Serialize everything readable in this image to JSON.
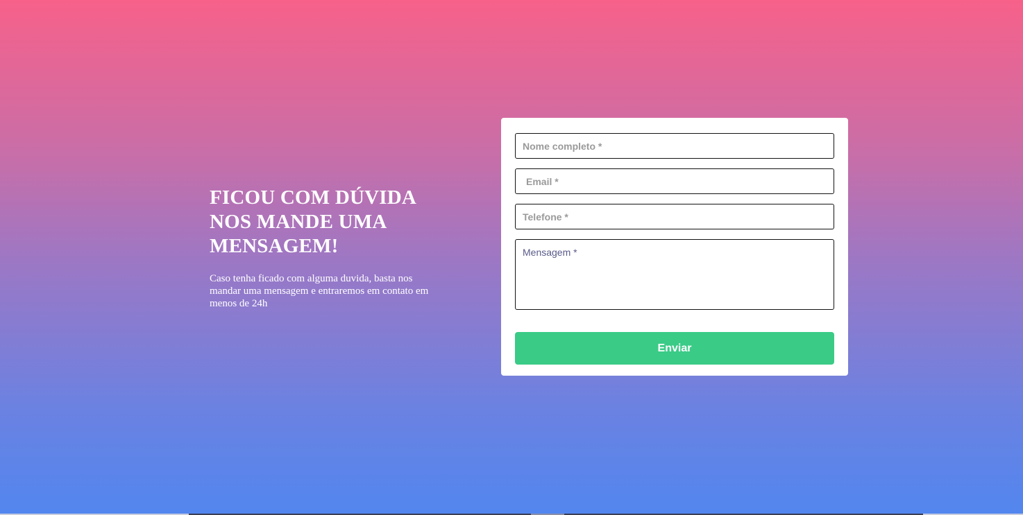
{
  "intro": {
    "heading_line1": "FICOU COM DÚVIDA",
    "heading_line2": "NOS MANDE UMA",
    "heading_line3": "MENSAGEM!",
    "description": "Caso tenha ficado com alguma duvida, basta nos mandar uma mensagem e entraremos em contato em menos de 24h"
  },
  "form": {
    "name_placeholder": "Nome completo *",
    "email_placeholder": "Email *",
    "phone_placeholder": "Telefone *",
    "message_placeholder": "Mensagem *",
    "submit_label": "Enviar"
  },
  "colors": {
    "gradient_top": "#f7618a",
    "gradient_bottom": "#5286ef",
    "button_green": "#3acb87",
    "card_background": "#ffffff"
  }
}
